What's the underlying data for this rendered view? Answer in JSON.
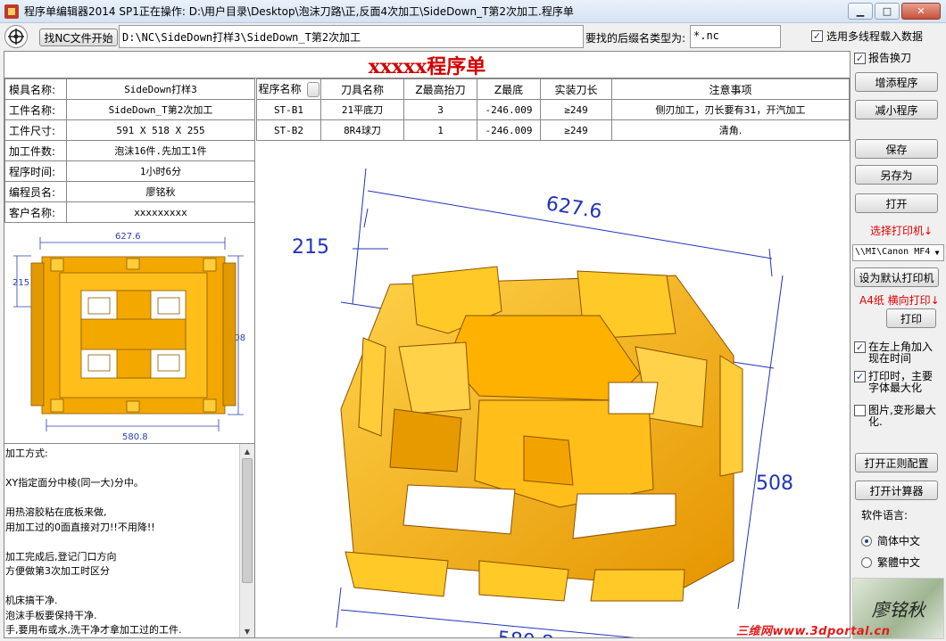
{
  "window": {
    "title": "程序单编辑器2014 SP1正在操作: D:\\用户目录\\Desktop\\泡沫刀路\\正,反面4次加工\\SideDown_T第2次加工.程序单",
    "min": "▁",
    "max": "□",
    "close": "✕"
  },
  "toolbar": {
    "find_btn": "找NC文件开始",
    "path": "D:\\NC\\SideDown打样3\\SideDown_T第2次加工",
    "ext_label": "要找的后缀名类型为:",
    "ext_value": "*.nc",
    "multi_label": "选用多线程载入数据",
    "multi_checked": "✓"
  },
  "sheet": {
    "title": "xxxxx程序单",
    "info": [
      {
        "label": "模具名称:",
        "value": "SideDown打样3"
      },
      {
        "label": "工件名称:",
        "value": "SideDown_T第2次加工"
      },
      {
        "label": "工件尺寸:",
        "value": "591 X 518 X 255"
      },
      {
        "label": "加工件数:",
        "value": "泡沫16件.先加工1件"
      },
      {
        "label": "程序时间:",
        "value": "1小时6分"
      },
      {
        "label": "编程员名:",
        "value": "廖铭秋"
      },
      {
        "label": "客户名称:",
        "value": "xxxxxxxxx"
      }
    ],
    "prog_headers": [
      "程序名称",
      "刀具名称",
      "Z最高抬刀",
      "Z最底",
      "实装刀长",
      "注意事项"
    ],
    "prog_rows": [
      [
        "ST-B1",
        "21平底刀",
        "3",
        "-246.009",
        "≥249",
        "侧刃加工，刃长要有31，开汽加工"
      ],
      [
        "ST-B2",
        "8R4球刀",
        "1",
        "-246.009",
        "≥249",
        "清角."
      ]
    ],
    "dims": {
      "width": "627.6",
      "depth": "215",
      "height": "508",
      "bottom": "580.8"
    },
    "notes": "加工方式:\n\nXY指定面分中棱(同一大)分中。\n\n用热溶胶粘在底板来做,\n用加工过的0面直接对刀!!不用降!!\n\n加工完成后,登记门口方向\n方便做第3次加工时区分\n\n机床搞干净.\n泡沫手板要保持干净.\n手,要用布或水,洗干净才拿加工过的工件.\n手,要用布,擦干净才开始搬写序单"
  },
  "panel": {
    "cb_swap": "报告换刀",
    "cb_swap_checked": "✓",
    "btn_add": "增添程序",
    "btn_remove": "减小程序",
    "btn_save": "保存",
    "btn_saveas": "另存为",
    "btn_open": "打开",
    "select_printer": "选择打印机↓",
    "printer": "\\\\MI\\Canon MF4",
    "btn_default_printer": "设为默认打印机",
    "paper_label": "A4纸  横向打印↓",
    "btn_print": "打印",
    "cb_time": "在左上角加入现在时间",
    "cb_time_checked": "✓",
    "cb_font": "打印时，主要字体最大化",
    "cb_font_checked": "✓",
    "cb_image": "图片,变形最大化.",
    "cb_image_checked": "",
    "btn_correction": "打开正则配置",
    "btn_calc": "打开计算器",
    "lang_label": "软件语言:",
    "lang_simplified": "简体中文",
    "lang_traditional": "繁體中文",
    "logo": "廖铭秋"
  },
  "watermark": "三维网www.3dportal.cn",
  "colors": {
    "title_red": "#d40000",
    "part_orange": "#f0a000",
    "dim_blue": "#2233bb"
  }
}
